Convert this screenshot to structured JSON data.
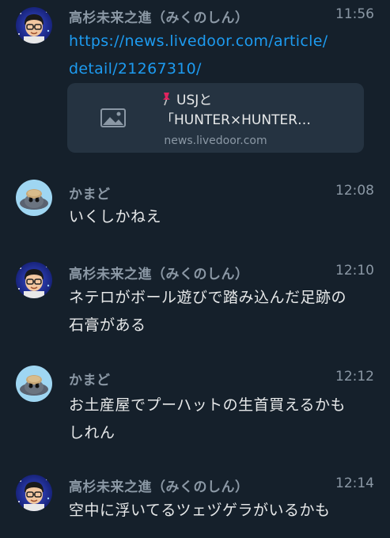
{
  "messages": [
    {
      "sender": "高杉未来之進（みくのしん）",
      "time": "11:56",
      "link_line1": "https://news.livedoor.com/article/",
      "link_line2": "detail/21267310/",
      "card": {
        "title_line1": "USJと",
        "title_line2": "「HUNTER×HUNTER…",
        "domain": "news.livedoor.com"
      }
    },
    {
      "sender": "かまど",
      "time": "12:08",
      "line1": "いくしかねえ"
    },
    {
      "sender": "高杉未来之進（みくのしん）",
      "time": "12:10",
      "line1": "ネテロがボール遊びで踏み込んだ足跡の",
      "line2": "石膏がある"
    },
    {
      "sender": "かまど",
      "time": "12:12",
      "line1": "お土産屋でプーハットの生首買えるかも",
      "line2": "しれん"
    },
    {
      "sender": "高杉未来之進（みくのしん）",
      "time": "12:14",
      "line1": "空中に浮いてるツェヅゲラがいるかも"
    }
  ],
  "colors": {
    "background": "#15202b",
    "link": "#1d9bf0",
    "meta": "#8b98a5",
    "card": "#253341"
  }
}
